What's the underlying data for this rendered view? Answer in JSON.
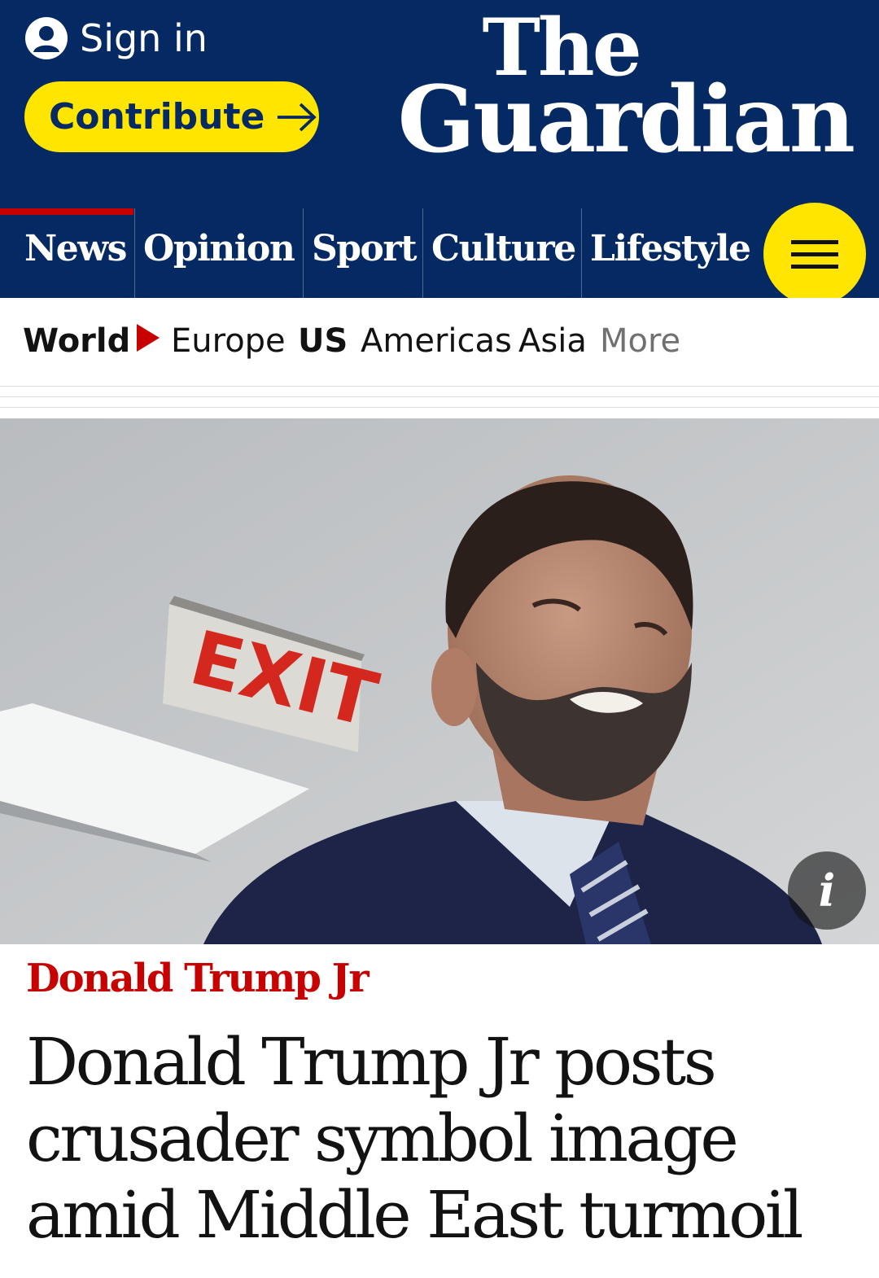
{
  "header": {
    "sign_in_label": "Sign in",
    "contribute_label": "Contribute",
    "logo_line1": "The",
    "logo_line2": "Guardian",
    "colors": {
      "brand": "#052962",
      "accent": "#ffe500",
      "news_red": "#c70000"
    }
  },
  "pillars": [
    {
      "label": "News",
      "active": true
    },
    {
      "label": "Opinion"
    },
    {
      "label": "Sport"
    },
    {
      "label": "Culture"
    },
    {
      "label": "Lifestyle"
    }
  ],
  "menu_icon": "hamburger-icon",
  "subnav": {
    "section": "World",
    "items": [
      "Europe",
      "US",
      "Americas",
      "Asia"
    ],
    "more_label": "More"
  },
  "hero_image": {
    "exit_sign_text": "EXIT",
    "info_label": "i"
  },
  "article": {
    "kicker": "Donald Trump Jr",
    "headline": "Donald Trump Jr posts crusader symbol image amid Middle East turmoil"
  }
}
